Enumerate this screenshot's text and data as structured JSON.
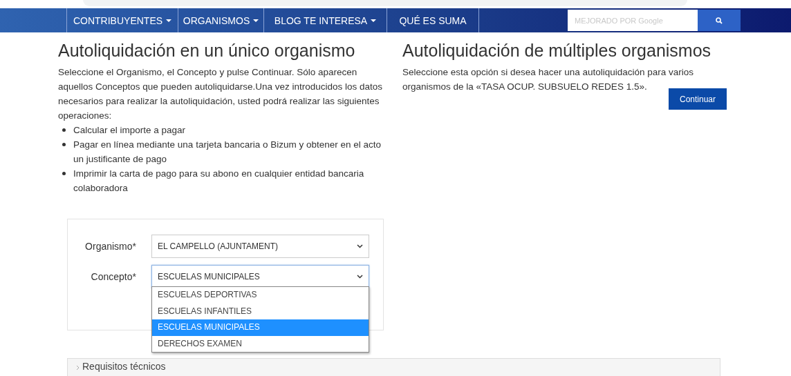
{
  "nav": {
    "items": [
      {
        "label": "CONTRIBUYENTES",
        "has_menu": true
      },
      {
        "label": "ORGANISMOS",
        "has_menu": true
      },
      {
        "label": "BLOG TE INTERESA",
        "has_menu": true
      },
      {
        "label": "QUÉ ES SUMA",
        "has_menu": false
      }
    ],
    "search": {
      "placeholder": "MEJORADO POR Google"
    }
  },
  "single": {
    "title": "Autoliquidación en un único organismo",
    "intro": "Seleccione el Organismo, el Concepto y pulse Continuar. Sólo aparecen aquellos Conceptos que pueden autoliquidarse.Una vez introducidos los datos necesarios para realizar la autoliquidación, usted podrá realizar las siguientes operaciones:",
    "bullets": [
      "Calcular el importe a pagar",
      "Pagar en línea mediante una tarjeta bancaria o Bizum y obtener en el acto un justificante de pago",
      "Imprimir la carta de pago para su abono en cualquier entidad bancaria colaboradora"
    ],
    "fields": [
      {
        "label": "Organismo*",
        "value": "EL CAMPELLO (AJUNTAMENT)",
        "expanded": false
      },
      {
        "label": "Concepto*",
        "value": "ESCUELAS MUNICIPALES",
        "expanded": true
      }
    ],
    "options": [
      {
        "label": "ESCUELAS DEPORTIVAS",
        "selected": false
      },
      {
        "label": "ESCUELAS INFANTILES",
        "selected": false
      },
      {
        "label": "ESCUELAS MUNICIPALES",
        "selected": true
      },
      {
        "label": "DERECHOS EXAMEN",
        "selected": false
      }
    ]
  },
  "multiple": {
    "title": "Autoliquidación de múltiples organismos",
    "text": "Seleccione esta opción si desea hacer una autoliquidación para varios organismos de la «TASA OCUP. SUBSUELO REDES 1.5».",
    "button": "Continuar"
  },
  "accordion": {
    "label": "Requisitos técnicos",
    "expanded": false
  }
}
